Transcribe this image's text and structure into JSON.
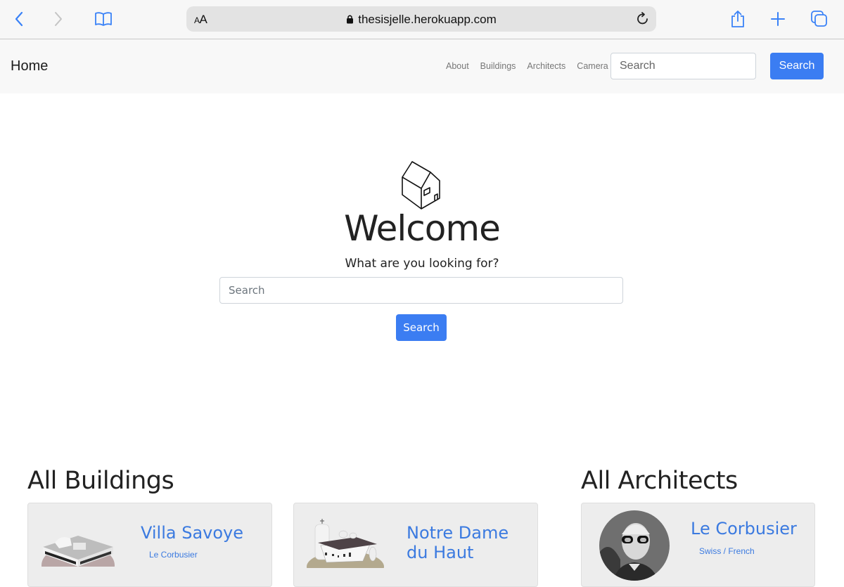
{
  "browser": {
    "url": "thesisjelle.herokuapp.com",
    "reader_label_small": "A",
    "reader_label_large": "A",
    "icons": {
      "back": "chevron-left-icon",
      "forward": "chevron-right-icon",
      "bookmarks": "book-icon",
      "lock": "lock-icon",
      "reload": "reload-icon",
      "share": "share-icon",
      "new_tab": "plus-icon",
      "tabs": "tabs-icon"
    },
    "accent_color": "#3a82f7"
  },
  "navbar": {
    "brand": "Home",
    "links": [
      "About",
      "Buildings",
      "Architects",
      "Camera"
    ],
    "search_placeholder": "Search",
    "search_button": "Search"
  },
  "hero": {
    "title": "Welcome",
    "subtitle": "What are you looking for?",
    "search_placeholder": "Search",
    "search_button": "Search",
    "icon": "house-outline-icon"
  },
  "buildings": {
    "heading": "All Buildings",
    "items": [
      {
        "name": "Villa Savoye",
        "architect": "Le Corbusier"
      },
      {
        "name": "Notre Dame du Haut",
        "architect": ""
      }
    ]
  },
  "architects": {
    "heading": "All Architects",
    "items": [
      {
        "name": "Le Corbusier",
        "nationality": "Swiss / French"
      }
    ]
  },
  "colors": {
    "primary_button": "#3b7df2",
    "link": "#3b7ae0",
    "navbar_bg": "#f8f8f8",
    "card_bg": "#ededed"
  }
}
